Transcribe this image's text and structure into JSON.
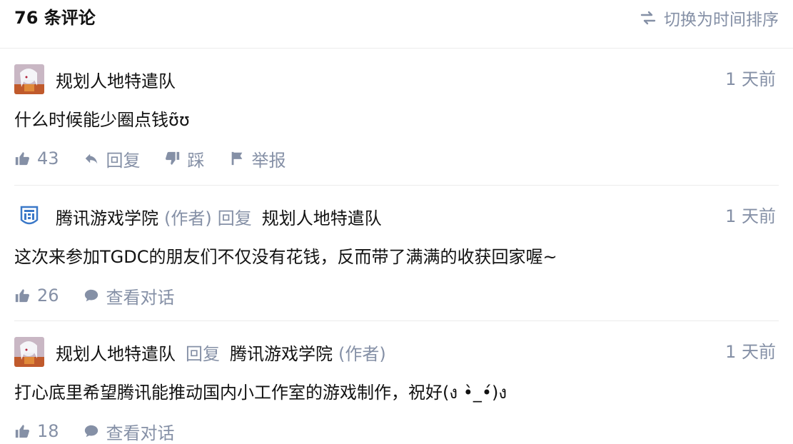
{
  "header": {
    "count_label": "76 条评论",
    "sort_label": "切换为时间排序",
    "sort_icon": "swap-arrows-icon"
  },
  "comments": [
    {
      "author": "规划人地特遣队",
      "time": "1 天前",
      "content": "什么时候能少圈点钱ʊ̃ʊ",
      "likes": "43",
      "actions": {
        "reply": "回复",
        "dislike": "踩",
        "report": "举报"
      }
    },
    {
      "author": "腾讯游戏学院",
      "author_tag": "(作者)",
      "reply_word": "回复",
      "reply_to": "规划人地特遣队",
      "time": "1 天前",
      "content": "这次来参加TGDC的朋友们不仅没有花钱，反而带了满满的收获回家喔~",
      "likes": "26",
      "actions": {
        "conversation": "查看对话"
      }
    },
    {
      "author": "规划人地特遣队",
      "reply_word": "回复",
      "reply_to": "腾讯游戏学院",
      "reply_to_tag": "(作者)",
      "time": "1 天前",
      "content": "打心底里希望腾讯能推动国内小工作室的游戏制作，祝好(ง •̀_•́)ง",
      "likes": "18",
      "actions": {
        "conversation": "查看对话"
      }
    }
  ],
  "colors": {
    "text": "#121212",
    "muted": "#8590a6",
    "divider": "#ebebeb"
  }
}
